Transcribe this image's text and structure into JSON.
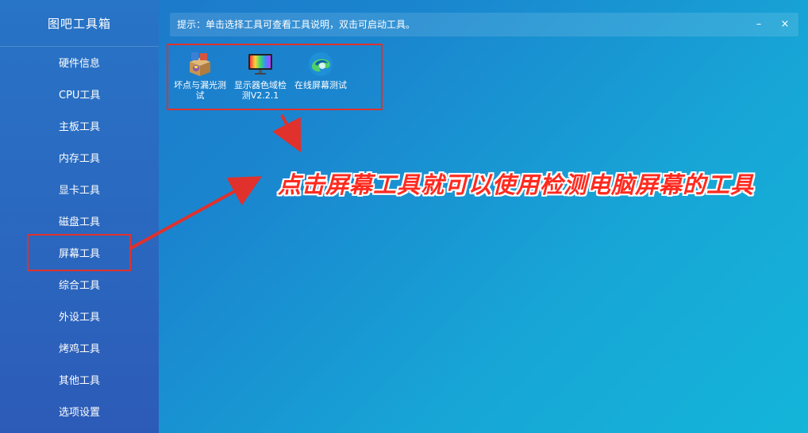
{
  "app_title": "图吧工具箱",
  "sidebar": {
    "items": [
      {
        "label": "硬件信息"
      },
      {
        "label": "CPU工具"
      },
      {
        "label": "主板工具"
      },
      {
        "label": "内存工具"
      },
      {
        "label": "显卡工具"
      },
      {
        "label": "磁盘工具"
      },
      {
        "label": "屏幕工具"
      },
      {
        "label": "综合工具"
      },
      {
        "label": "外设工具"
      },
      {
        "label": "烤鸡工具"
      },
      {
        "label": "其他工具"
      },
      {
        "label": "选项设置"
      }
    ]
  },
  "topbar": {
    "hint": "提示：单击选择工具可查看工具说明，双击可启动工具。",
    "minimize_symbol": "–",
    "close_symbol": "×"
  },
  "tools": [
    {
      "label": "坏点与漏光测试",
      "icon": "box-package-icon"
    },
    {
      "label": "显示器色域检测V2.2.1",
      "icon": "color-monitor-icon"
    },
    {
      "label": "在线屏幕测试",
      "icon": "edge-browser-icon"
    }
  ],
  "annotation": {
    "callout": "点击屏幕工具就可以使用检测电脑屏幕的工具",
    "highlight_color": "#e0312d"
  }
}
